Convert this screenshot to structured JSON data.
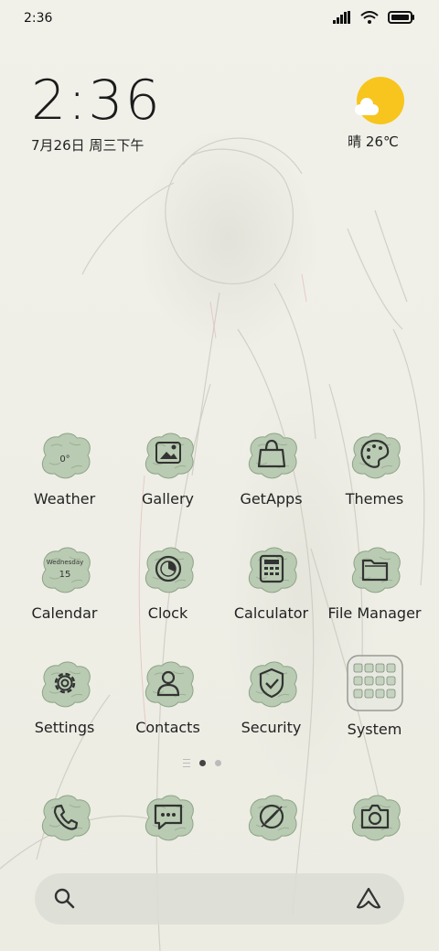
{
  "status_bar": {
    "time": "2:36",
    "icons": [
      "signal-icon",
      "wifi-icon",
      "battery-icon"
    ]
  },
  "clock_widget": {
    "time": "2:36",
    "date": "7月26日 周三下午"
  },
  "weather_widget": {
    "condition": "晴",
    "temperature": "26℃",
    "icon": "sun-cloud-icon",
    "sun_color": "#f7c51d"
  },
  "apps": [
    {
      "label": "Weather",
      "icon": "weather-icon",
      "badge": "0°"
    },
    {
      "label": "Gallery",
      "icon": "gallery-icon"
    },
    {
      "label": "GetApps",
      "icon": "shopping-bag-icon"
    },
    {
      "label": "Themes",
      "icon": "palette-icon"
    },
    {
      "label": "Calendar",
      "icon": "calendar-icon",
      "weekday": "Wednesday",
      "day": "15"
    },
    {
      "label": "Clock",
      "icon": "clock-icon"
    },
    {
      "label": "Calculator",
      "icon": "calculator-icon"
    },
    {
      "label": "File Manager",
      "icon": "folder-icon"
    },
    {
      "label": "Settings",
      "icon": "gear-icon"
    },
    {
      "label": "Contacts",
      "icon": "contact-icon"
    },
    {
      "label": "Security",
      "icon": "shield-icon"
    },
    {
      "label": "System",
      "icon": "folder-grid-icon"
    }
  ],
  "page_indicator": {
    "pages": 2,
    "active": 1
  },
  "dock": [
    {
      "icon": "phone-icon"
    },
    {
      "icon": "messages-icon"
    },
    {
      "icon": "browser-icon"
    },
    {
      "icon": "camera-icon"
    }
  ],
  "search_bar": {
    "left_icon": "search-icon",
    "right_icon": "assistant-icon"
  },
  "colors": {
    "icon_blob": "#b9cbb2",
    "background": "#efefe7",
    "text": "#222222"
  }
}
